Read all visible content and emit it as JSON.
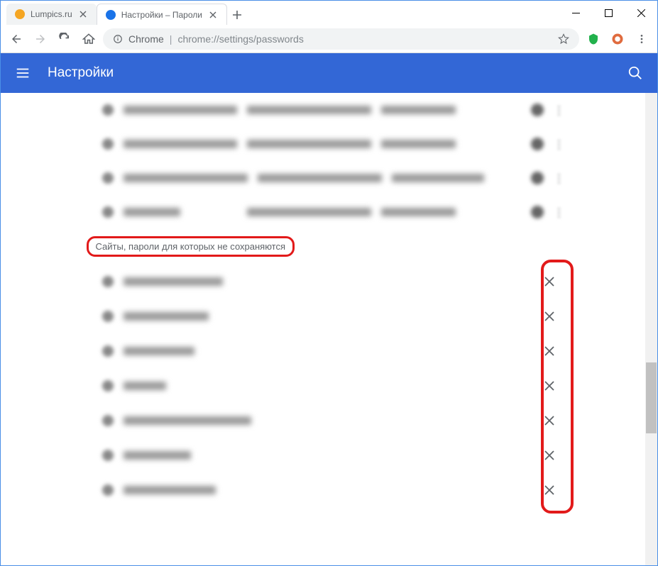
{
  "window": {
    "tabs": [
      {
        "title": "Lumpics.ru",
        "active": false,
        "favicon": "#f5a623"
      },
      {
        "title": "Настройки – Пароли",
        "active": true,
        "favicon": "#1a73e8"
      }
    ]
  },
  "toolbar": {
    "secure_label": "Chrome",
    "url": "chrome://settings/passwords"
  },
  "settings": {
    "header_title": "Настройки",
    "never_save_heading": "Сайты, пароли для которых не сохраняются"
  },
  "saved_passwords_visible_rows": 4,
  "never_save_rows": 7,
  "icons": {
    "hamburger": "menu-icon",
    "search": "search-icon",
    "star": "star-icon",
    "shield": "shield-icon",
    "adblock": "adblock-icon"
  },
  "annotation": {
    "color": "#e21a1a"
  }
}
